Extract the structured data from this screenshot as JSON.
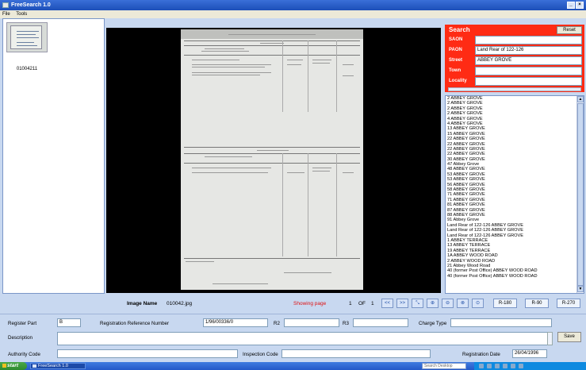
{
  "window": {
    "title": "FreeSearch 1.0"
  },
  "menu": {
    "items": [
      "File",
      "Tools"
    ]
  },
  "thumbnail": {
    "label": "01004211"
  },
  "search": {
    "title": "Search",
    "reset_label": "Reset",
    "fields": [
      {
        "label": "SAON",
        "value": ""
      },
      {
        "label": "PAON",
        "value": "Land Rear of 122-126"
      },
      {
        "label": "Street",
        "value": "ABBEY GROVE"
      },
      {
        "label": "Town",
        "value": ""
      },
      {
        "label": "Locality",
        "value": ""
      }
    ]
  },
  "results": [
    "2 ABBEY GROVE",
    "2 ABBEY GROVE",
    "2 ABBEY GROVE",
    "2 ABBEY GROVE",
    "4 ABBEY GROVE",
    "4 ABBEY GROVE",
    "13 ABBEY GROVE",
    "15 ABBEY GROVE",
    "22 ABBEY GROVE",
    "22 ABBEY GROVE",
    "22 ABBEY GROVE",
    "22 ABBEY GROVE",
    "30 ABBEY GROVE",
    "47 Abbey Grove",
    "48 ABBEY GROVE",
    "53 ABBEY GROVE",
    "53 ABBEY GROVE",
    "56 ABBEY GROVE",
    "58 ABBEY GROVE",
    "71 ABBEY GROVE",
    "71 ABBEY GROVE",
    "81 ABBEY GROVE",
    "87 ABBEY GROVE",
    "88 ABBEY GROVE",
    "91 Abbey Grove",
    "Land Rear of 122-126 ABBEY GROVE",
    "Land Rear of 122-126 ABBEY GROVE",
    "Land Rear of 122-126 ABBEY GROVE",
    "1 ABBEY TERRACE",
    "13 ABBEY TERRACE",
    "19 ABBEY TERRACE",
    "1A ABBEY WOOD ROAD",
    "2 ABBEY WOOD ROAD",
    "21 Abbey Wood Road",
    "40 (former Post Office) ABBEY WOOD ROAD",
    "40 (former Post Office) ABBEY WOOD ROAD"
  ],
  "navigation": {
    "image_name_label": "Image Name",
    "image_name_value": "010042.jpg",
    "showing_label": "Showing page",
    "page_current": "1",
    "page_of": "OF",
    "page_total": "1",
    "nav_buttons": [
      "<<",
      ">>"
    ],
    "rotate_buttons": [
      "R-180",
      "R-90",
      "R-270"
    ]
  },
  "record": {
    "register_part_label": "Register Part",
    "register_part_value": "B",
    "reg_ref_label": "Registration Reference Number",
    "reg_ref_value": "1/96/00336/0",
    "r2_label": "R2",
    "r2_value": "",
    "r3_label": "R3",
    "r3_value": "",
    "charge_type_label": "Charge Type",
    "charge_type_value": "",
    "description_label": "Description",
    "description_value": "",
    "save_label": "Save",
    "authority_code_label": "Authority Code",
    "authority_code_value": "",
    "inspection_code_label": "Inspection Code",
    "inspection_code_value": "",
    "registration_date_label": "Registration Date",
    "registration_date_value": "26/04/1996"
  },
  "taskbar": {
    "start_label": "start",
    "task_item": "FreeSearch 1.0",
    "search_placeholder": "Search Desktop"
  }
}
